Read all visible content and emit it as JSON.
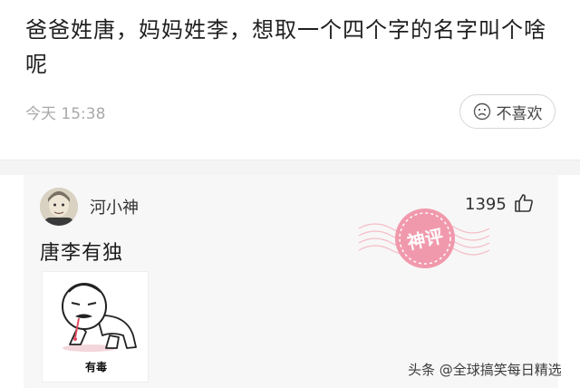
{
  "post": {
    "question": "爸爸姓唐，妈妈姓李，想取一个四个字的名字叫个啥呢",
    "time": "今天 15:38",
    "dislike_label": "不喜欢"
  },
  "comment": {
    "user_name": "河小神",
    "like_count": "1395",
    "text": "唐李有独",
    "badge_text": "神评",
    "sticker_caption": "有毒"
  },
  "watermark": "头条 @全球搞笑每日精选",
  "icons": {
    "dislike": "sad-face-icon",
    "like": "thumbs-up-icon",
    "badge": "god-comment-stamp"
  },
  "colors": {
    "stamp": "#f07a93",
    "card_bg": "#f7f7f7",
    "time_gray": "#a9a9a9"
  }
}
